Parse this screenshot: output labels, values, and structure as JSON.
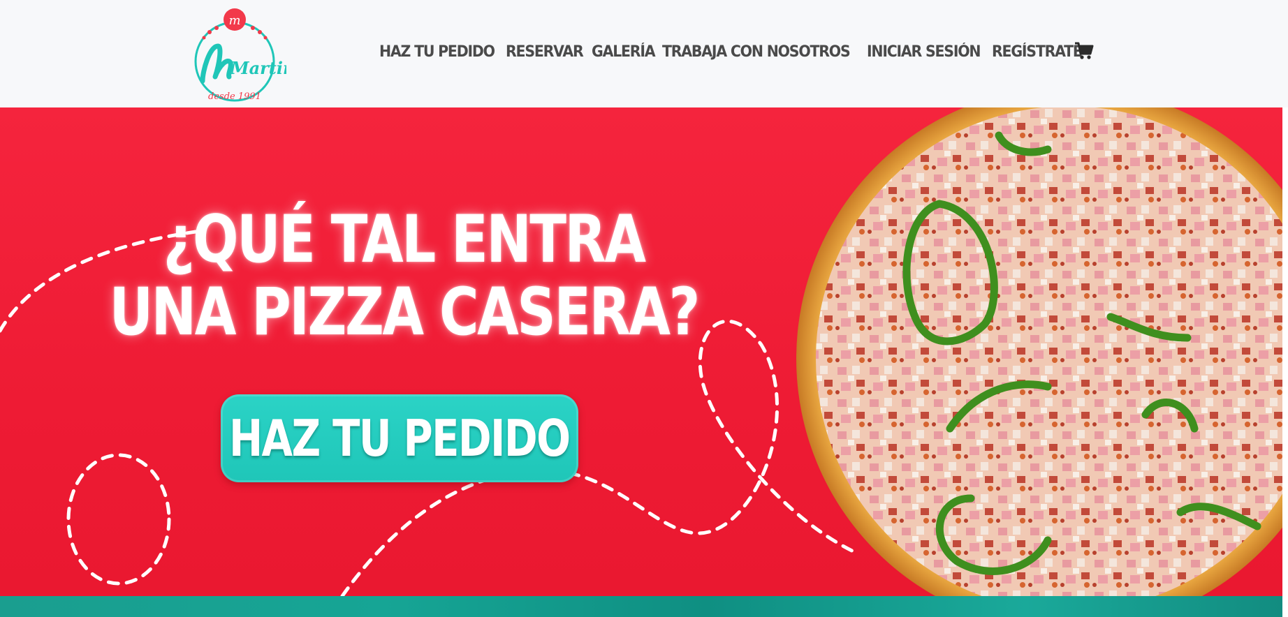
{
  "brand": {
    "logo_text": "Martino",
    "logo_tagline": "desde 1991",
    "colors": {
      "red": "#ee1b34",
      "teal": "#1fc6b8",
      "nav_text": "#4a4a4a"
    }
  },
  "nav": {
    "items": [
      {
        "label": "HAZ TU PEDIDO"
      },
      {
        "label": "RESERVAR"
      },
      {
        "label": "GALERÍA"
      },
      {
        "label": "TRABAJA CON NOSOTROS"
      },
      {
        "label": "INICIAR SESIÓN"
      },
      {
        "label": "REGÍSTRATE"
      }
    ],
    "cart_icon": "shopping-cart-icon"
  },
  "hero": {
    "headline_line1": "¿QUÉ TAL ENTRA",
    "headline_line2": "UNA PIZZA CASERA?",
    "cta_label": "HAZ TU PEDIDO",
    "image": "pizza-photo"
  }
}
